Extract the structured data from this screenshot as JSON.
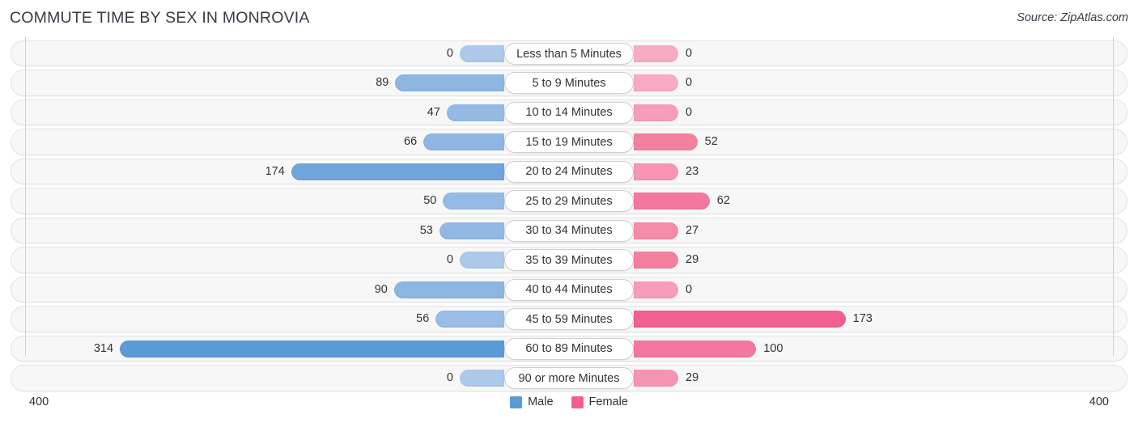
{
  "header": {
    "title": "COMMUTE TIME BY SEX IN MONROVIA",
    "source": "Source: ZipAtlas.com"
  },
  "axis": {
    "left_max": "400",
    "right_max": "400",
    "max_value": 400
  },
  "legend": {
    "items": [
      {
        "label": "Male",
        "color": "#5B9BD5"
      },
      {
        "label": "Female",
        "color": "#F2608F"
      }
    ]
  },
  "colors": {
    "male_light": "#ADC9EA",
    "male_mid": "#8EB6E2",
    "male_strong": "#5B9BD5",
    "female_light": "#F9ABC4",
    "female_mid": "#F58BAE",
    "female_strong": "#F2608F",
    "track_bg": "#f7f7f7",
    "track_border": "#e3e3e3",
    "axis_line": "#d2d2d6"
  },
  "chart_data": {
    "type": "bar",
    "title": "COMMUTE TIME BY SEX IN MONROVIA",
    "subtitle": "",
    "xlabel": "",
    "ylabel": "",
    "orientation": "horizontal-diverging",
    "xlim": [
      0,
      400
    ],
    "grid": false,
    "legend_position": "bottom-center",
    "categories": [
      "Less than 5 Minutes",
      "5 to 9 Minutes",
      "10 to 14 Minutes",
      "15 to 19 Minutes",
      "20 to 24 Minutes",
      "25 to 29 Minutes",
      "30 to 34 Minutes",
      "35 to 39 Minutes",
      "40 to 44 Minutes",
      "45 to 59 Minutes",
      "60 to 89 Minutes",
      "90 or more Minutes"
    ],
    "series": [
      {
        "name": "Male",
        "values": [
          0,
          89,
          47,
          66,
          174,
          50,
          53,
          0,
          90,
          56,
          314,
          0
        ]
      },
      {
        "name": "Female",
        "values": [
          0,
          0,
          0,
          52,
          23,
          62,
          27,
          29,
          0,
          173,
          100,
          29
        ]
      }
    ]
  },
  "rows": [
    {
      "category": "Less than 5 Minutes",
      "male": "0",
      "male_value": 0,
      "male_color": "#ADC9EA",
      "female": "0",
      "female_value": 0,
      "female_color": "#F9ABC4"
    },
    {
      "category": "5 to 9 Minutes",
      "male": "89",
      "male_value": 89,
      "male_color": "#8EB6E2",
      "female": "0",
      "female_value": 0,
      "female_color": "#F9ABC4"
    },
    {
      "category": "10 to 14 Minutes",
      "male": "47",
      "male_value": 47,
      "male_color": "#95BAE4",
      "female": "0",
      "female_value": 0,
      "female_color": "#F79DBA"
    },
    {
      "category": "15 to 19 Minutes",
      "male": "66",
      "male_value": 66,
      "male_color": "#8EB6E2",
      "female": "52",
      "female_value": 52,
      "female_color": "#F4809F"
    },
    {
      "category": "20 to 24 Minutes",
      "male": "174",
      "male_value": 174,
      "male_color": "#6FA5DA",
      "female": "23",
      "female_value": 23,
      "female_color": "#F795B3"
    },
    {
      "category": "25 to 29 Minutes",
      "male": "50",
      "male_value": 50,
      "male_color": "#95BAE4",
      "female": "62",
      "female_value": 62,
      "female_color": "#F3779F"
    },
    {
      "category": "30 to 34 Minutes",
      "male": "53",
      "male_value": 53,
      "male_color": "#93B8E3",
      "female": "27",
      "female_value": 27,
      "female_color": "#F68BAA"
    },
    {
      "category": "35 to 39 Minutes",
      "male": "0",
      "male_value": 0,
      "male_color": "#ADC9EA",
      "female": "29",
      "female_value": 29,
      "female_color": "#F4809F"
    },
    {
      "category": "40 to 44 Minutes",
      "male": "90",
      "male_value": 90,
      "male_color": "#8CB5E1",
      "female": "0",
      "female_value": 0,
      "female_color": "#F79DBA"
    },
    {
      "category": "45 to 59 Minutes",
      "male": "56",
      "male_value": 56,
      "male_color": "#99BDE5",
      "female": "173",
      "female_value": 173,
      "female_color": "#F2608F"
    },
    {
      "category": "60 to 89 Minutes",
      "male": "314",
      "male_value": 314,
      "male_color": "#5B9BD5",
      "female": "100",
      "female_value": 100,
      "female_color": "#F3779F"
    },
    {
      "category": "90 or more Minutes",
      "male": "0",
      "male_value": 0,
      "male_color": "#ADC9EA",
      "female": "29",
      "female_value": 29,
      "female_color": "#F794B2"
    }
  ]
}
